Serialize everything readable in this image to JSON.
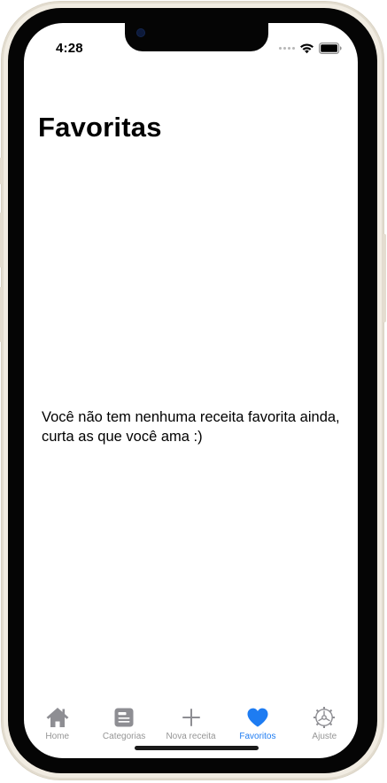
{
  "status_bar": {
    "time": "4:28"
  },
  "header": {
    "title": "Favoritas"
  },
  "main": {
    "empty_message": "Você não tem nenhuma receita favorita ainda, curta as que você ama :)"
  },
  "tab_bar": {
    "active_index": 3,
    "active_color": "#1e7cf2",
    "inactive_color": "#8e8e93",
    "items": [
      {
        "label": "Home",
        "icon": "house-icon"
      },
      {
        "label": "Categorias",
        "icon": "list-card-icon"
      },
      {
        "label": "Nova receita",
        "icon": "plus-icon"
      },
      {
        "label": "Favoritos",
        "icon": "heart-icon"
      },
      {
        "label": "Ajuste",
        "icon": "gear-icon"
      }
    ]
  }
}
